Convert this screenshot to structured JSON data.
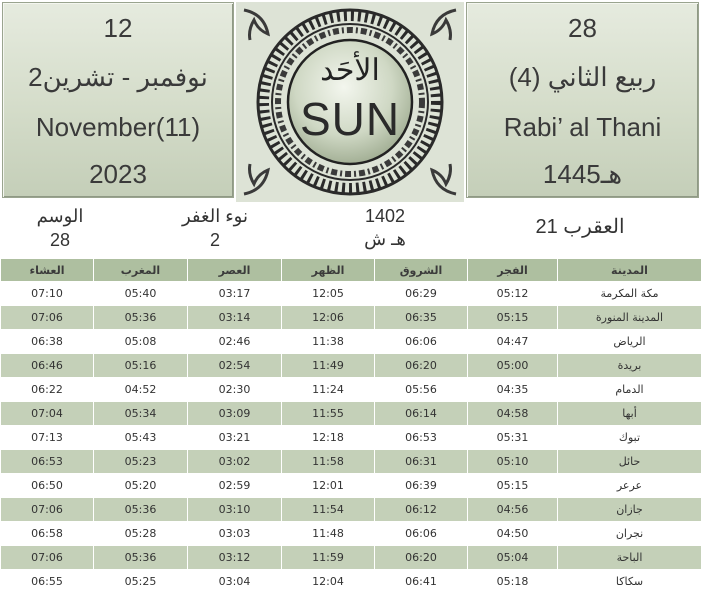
{
  "gregorian": {
    "day": "12",
    "month_ar": "نوفمبر - تشرين2",
    "month_en": "November(11)",
    "year": "2023"
  },
  "day_name": {
    "ar": "الأحَد",
    "en": "SUN"
  },
  "hijri": {
    "day": "28",
    "month_ar": "ربيع الثاني (4)",
    "month_en": "Rabi’ al Thani",
    "year": "1445هـ"
  },
  "info": {
    "wasm_label": "الوسم",
    "wasm_value": "28",
    "ghafr_label": "نوء الغفر",
    "ghafr_value": "2",
    "solar_year": "1402",
    "solar_suffix": "هـ ش",
    "zodiac": "21 العقرب"
  },
  "table": {
    "headers": {
      "city": "المدينة",
      "fajr": "الفجر",
      "shurooq": "الشروق",
      "dhuhr": "الظهر",
      "asr": "العصر",
      "maghrib": "المغرب",
      "isha": "العشاء"
    },
    "rows": [
      {
        "city": "مكة المكرمة",
        "fajr": "05:12",
        "shurooq": "06:29",
        "dhuhr": "12:05",
        "asr": "03:17",
        "maghrib": "05:40",
        "isha": "07:10"
      },
      {
        "city": "المدينة المنورة",
        "fajr": "05:15",
        "shurooq": "06:35",
        "dhuhr": "12:06",
        "asr": "03:14",
        "maghrib": "05:36",
        "isha": "07:06"
      },
      {
        "city": "الرياض",
        "fajr": "04:47",
        "shurooq": "06:06",
        "dhuhr": "11:38",
        "asr": "02:46",
        "maghrib": "05:08",
        "isha": "06:38"
      },
      {
        "city": "بريدة",
        "fajr": "05:00",
        "shurooq": "06:20",
        "dhuhr": "11:49",
        "asr": "02:54",
        "maghrib": "05:16",
        "isha": "06:46"
      },
      {
        "city": "الدمام",
        "fajr": "04:35",
        "shurooq": "05:56",
        "dhuhr": "11:24",
        "asr": "02:30",
        "maghrib": "04:52",
        "isha": "06:22"
      },
      {
        "city": "أبها",
        "fajr": "04:58",
        "shurooq": "06:14",
        "dhuhr": "11:55",
        "asr": "03:09",
        "maghrib": "05:34",
        "isha": "07:04"
      },
      {
        "city": "تبوك",
        "fajr": "05:31",
        "shurooq": "06:53",
        "dhuhr": "12:18",
        "asr": "03:21",
        "maghrib": "05:43",
        "isha": "07:13"
      },
      {
        "city": "حائل",
        "fajr": "05:10",
        "shurooq": "06:31",
        "dhuhr": "11:58",
        "asr": "03:02",
        "maghrib": "05:23",
        "isha": "06:53"
      },
      {
        "city": "عرعر",
        "fajr": "05:15",
        "shurooq": "06:39",
        "dhuhr": "12:01",
        "asr": "02:59",
        "maghrib": "05:20",
        "isha": "06:50"
      },
      {
        "city": "جازان",
        "fajr": "04:56",
        "shurooq": "06:12",
        "dhuhr": "11:54",
        "asr": "03:10",
        "maghrib": "05:36",
        "isha": "07:06"
      },
      {
        "city": "نجران",
        "fajr": "04:50",
        "shurooq": "06:06",
        "dhuhr": "11:48",
        "asr": "03:03",
        "maghrib": "05:28",
        "isha": "06:58"
      },
      {
        "city": "الباحة",
        "fajr": "05:04",
        "shurooq": "06:20",
        "dhuhr": "11:59",
        "asr": "03:12",
        "maghrib": "05:36",
        "isha": "07:06"
      },
      {
        "city": "سكاكا",
        "fajr": "05:18",
        "shurooq": "06:41",
        "dhuhr": "12:04",
        "asr": "03:04",
        "maghrib": "05:25",
        "isha": "06:55"
      }
    ]
  }
}
